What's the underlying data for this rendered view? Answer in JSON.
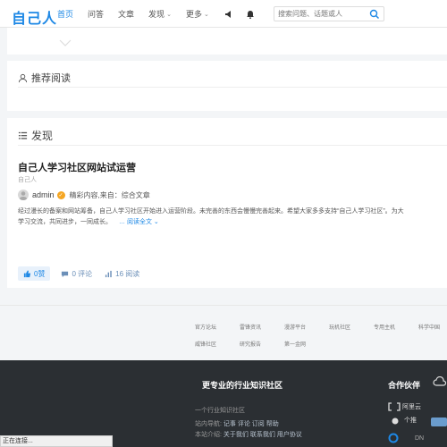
{
  "header": {
    "logo": "自己人",
    "nav": [
      "首页",
      "问答",
      "文章",
      "发现",
      "更多"
    ],
    "search_placeholder": "搜索问题、话题或人"
  },
  "recommend": {
    "title": "推荐阅读"
  },
  "discover": {
    "title": "发现",
    "post": {
      "title": "自己人学习社区网站试运营",
      "source": "自己人",
      "author": "admin",
      "meta": "精彩内容,来自：综合文章",
      "excerpt": "经过漫长的备案和网站筹备，自己人学习社区开始进入运营阶段。未完善的东西会慢慢完善起来。希望大家多多支持“自己人学习社区”。为大",
      "excerpt2": "学习交流，共同进步，一同成长。",
      "read_more": "阅读全文",
      "likes": "0赞",
      "comments": "0 评论",
      "views": "16 阅读"
    }
  },
  "links": {
    "row1": [
      "官方论坛",
      "雷锋资讯",
      "漫游平台",
      "玩机社区",
      "专用主机",
      "科学中国"
    ],
    "row2": [
      "威锋社区",
      "研究报告",
      "第一金网"
    ]
  },
  "footer": {
    "slogan": "更专业的行业知识社区",
    "partner_title": "合作伙伴",
    "line1": "一个行业知识社区",
    "line2_label": "站内导航:",
    "line2_links": "记事 评论 订阅 帮助",
    "line3_label": "本站介绍:",
    "line3_links": "关于我们 联系我们 用户协议",
    "partners": [
      "阿里云",
      "个推",
      "DN"
    ]
  },
  "status": "正在连接..."
}
